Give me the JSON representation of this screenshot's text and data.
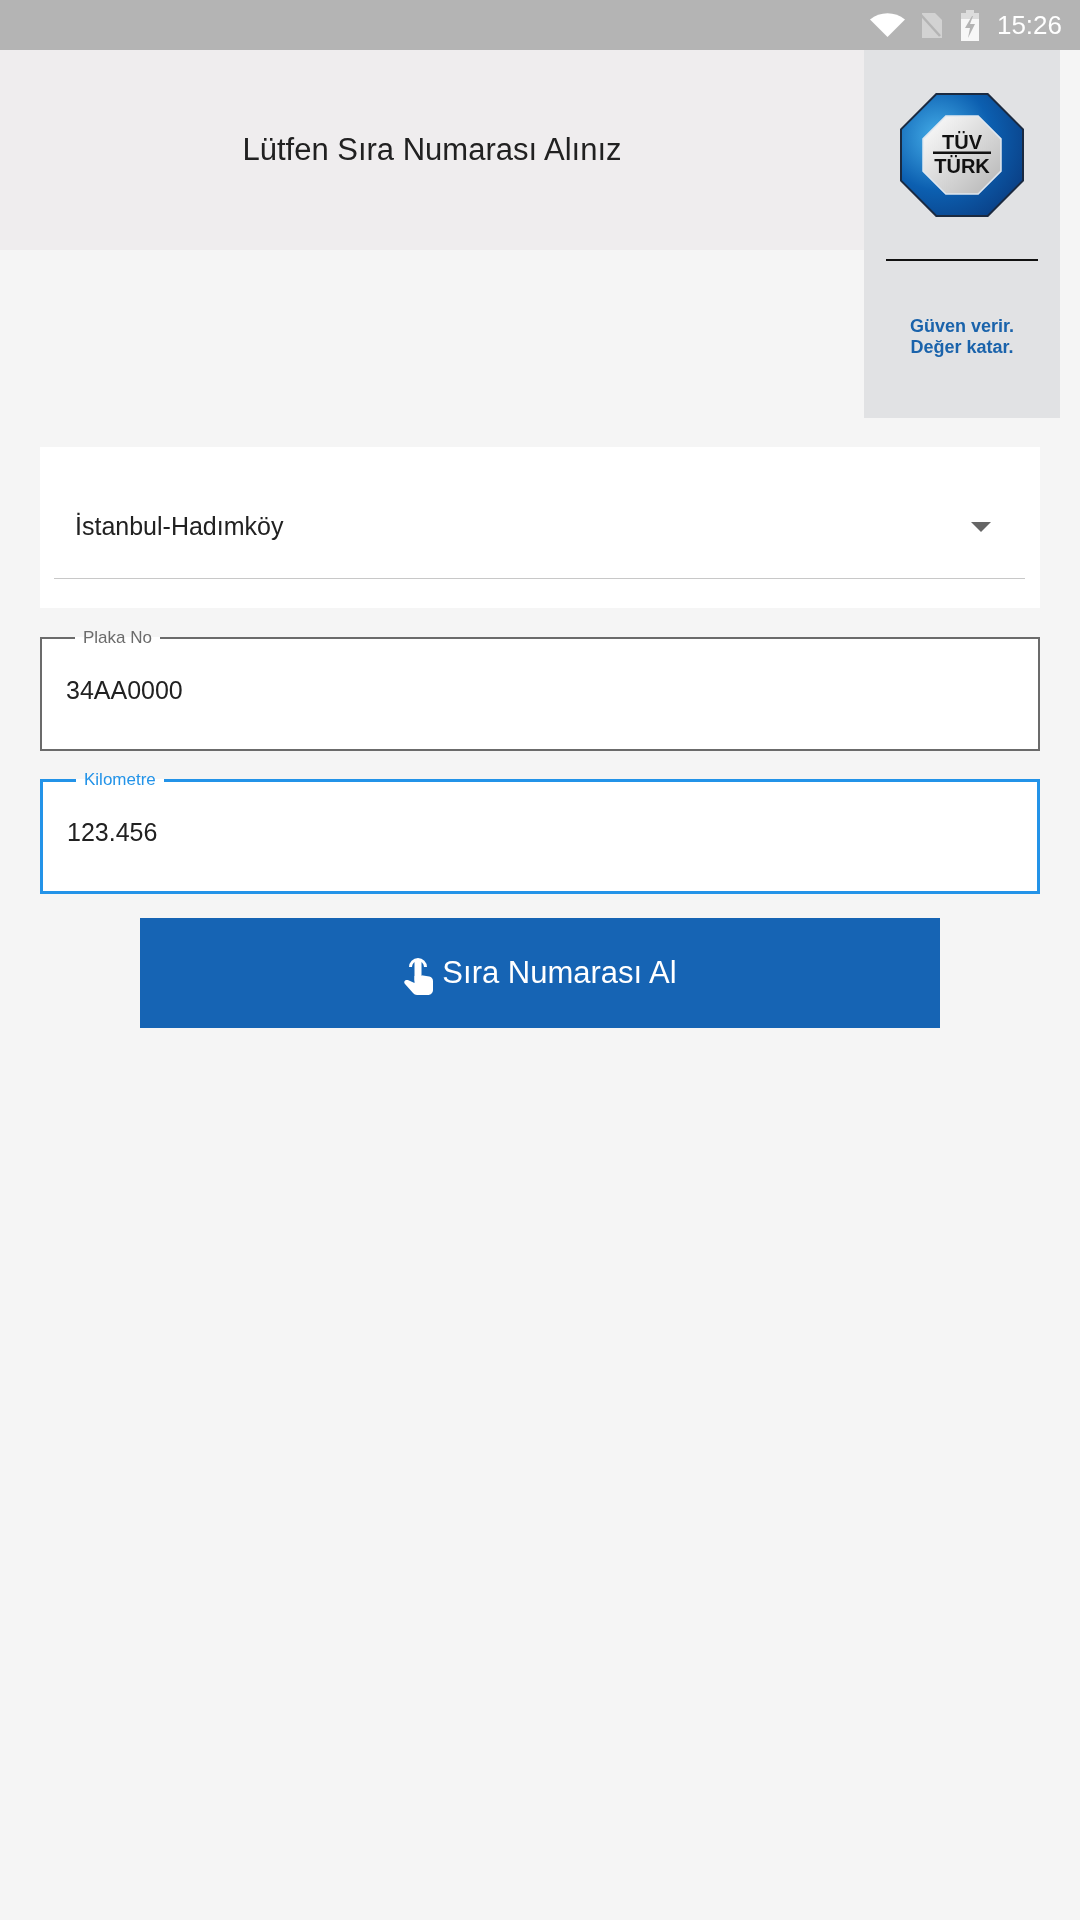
{
  "status_bar": {
    "time": "15:26"
  },
  "header": {
    "title": "Lütfen Sıra Numarası Alınız"
  },
  "logo": {
    "wordmark_top": "TÜV",
    "wordmark_bottom": "TÜRK",
    "slogan_lines": [
      "Güven verir.",
      "Değer katar."
    ]
  },
  "station_select": {
    "value": "İstanbul-Hadımköy"
  },
  "fields": [
    {
      "label": "Plaka No",
      "value": "34AA0000",
      "focused": false
    },
    {
      "label": "Kilometre",
      "value": "123.456",
      "focused": true
    }
  ],
  "submit_button": {
    "label": "Sıra Numarası Al"
  }
}
